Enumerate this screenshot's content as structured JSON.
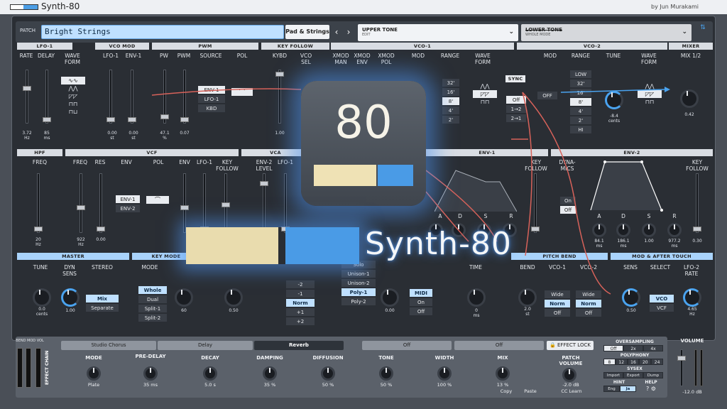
{
  "app": {
    "title": "Synth-80",
    "author": "by Jun Murakami"
  },
  "patch": {
    "label": "PATCH",
    "name": "Bright Strings",
    "category": "Pad & Strings"
  },
  "tones": {
    "upper": {
      "name": "UPPER TONE",
      "sub": "EDIT"
    },
    "lower": {
      "name": "LOWER TONE",
      "sub": "WHOLE MODE"
    }
  },
  "sections": {
    "lfo1": "LFO-1",
    "vcomod": "VCO MOD",
    "pwm": "PWM",
    "keyfollow": "KEY FOLLOW",
    "vco1": "VCO-1",
    "vco2": "VCO-2",
    "mixer": "MIXER",
    "hpf": "HPF",
    "vcf": "VCF",
    "vca": "VCA",
    "env1": "ENV-1",
    "env2": "ENV-2",
    "master": "MASTER",
    "keymode": "KEY MODE",
    "pitchbend": "PITCH BEND",
    "modafter": "MOD & AFTER TOUCH"
  },
  "lfo1": {
    "rate_label": "RATE",
    "delay_label": "DELAY",
    "wave_label": "WAVE FORM",
    "rate_value": "3.72",
    "rate_unit": "Hz",
    "delay_value": "85",
    "delay_unit": "ms"
  },
  "vcomod": {
    "lfo1_label": "LFO-1",
    "env1_label": "ENV-1",
    "lfo1_value": "0.00",
    "lfo1_unit": "st",
    "env1_value": "0.00",
    "env1_unit": "st"
  },
  "pwm": {
    "pw_label": "PW",
    "pwm_label": "PWM",
    "source_label": "SOURCE",
    "pol_label": "POL",
    "pw_value": "47.1",
    "pw_unit": "%",
    "pwm_value": "0.07",
    "sources": [
      "ENV-1",
      "LFO-1",
      "KBD"
    ]
  },
  "keyfollow": {
    "kybd_label": "KYBD",
    "vcosel_label": "VCO SEL",
    "kybd_value": "1.00"
  },
  "vco1": {
    "xmodman_label": "XMOD MAN",
    "xmodenv_label": "XMOD ENV",
    "xmodpol_label": "XMOD POL",
    "mod_label": "MOD",
    "range_label": "RANGE",
    "wave_label": "WAVE FORM",
    "ranges": [
      "32'",
      "16'",
      "8'",
      "4'",
      "2'"
    ],
    "range_selected": 2
  },
  "vco2": {
    "mod_label": "MOD",
    "range_label": "RANGE",
    "tune_label": "TUNE",
    "wave_label": "WAVE FORM",
    "sync_label": "SYNC",
    "sync_options": [
      "Off",
      "1→2",
      "2→1"
    ],
    "mod_value": "OFF",
    "ranges": [
      "LOW",
      "32'",
      "16'",
      "8'",
      "4'",
      "2'",
      "HI"
    ],
    "range_selected": 3,
    "tune_value": "-8.4",
    "tune_unit": "cents"
  },
  "mixer": {
    "mix_label": "MIX 1/2",
    "mix_value": "0.42"
  },
  "hpf": {
    "freq_label": "FREQ",
    "freq_value": "20",
    "freq_unit": "Hz"
  },
  "vcf": {
    "freq_label": "FREQ",
    "res_label": "RES",
    "env_label": "ENV",
    "pol_label": "POL",
    "env2_label": "ENV",
    "lfo1_label": "LFO-1",
    "kf_label": "KEY FOLLOW",
    "freq_value": "922",
    "freq_unit": "Hz",
    "res_value": "0.00",
    "sources": [
      "ENV-1",
      "ENV-2"
    ]
  },
  "vca": {
    "env2_label": "ENV-2 LEVEL",
    "lfo1_label": "LFO-1"
  },
  "env1": {
    "kf_label": "KEY FOLLOW",
    "dyn_label": "DYNA- MICS",
    "a": "A",
    "d": "D",
    "s": "S",
    "r": "R",
    "dyn_options": [
      "On",
      "Off"
    ]
  },
  "env2": {
    "a": "A",
    "d": "D",
    "s": "S",
    "r": "R",
    "kf_label": "KEY FOLLOW",
    "a_value": "84.1",
    "a_unit": "ms",
    "d_value": "186.1",
    "d_unit": "ms",
    "s_value": "1.00",
    "r_value": "977.2",
    "r_unit": "ms",
    "kf_value": "0.30"
  },
  "master": {
    "tune_label": "TUNE",
    "dyn_label": "DYN SENS",
    "stereo_label": "STEREO",
    "tune_value": "0.0",
    "tune_unit": "cents",
    "dyn_value": "1.00",
    "stereo_options": [
      "Mix",
      "Separate"
    ]
  },
  "keymode": {
    "mode_label": "MODE",
    "split_label": "SPLIT POINT",
    "upper_label": "LOWER UPPER",
    "modes": [
      "Whole",
      "Dual",
      "Split-1",
      "Split-2"
    ],
    "split_value": "60",
    "upper_value": "0.50"
  },
  "shift": {
    "label": "SHIFT",
    "options": [
      "-2",
      "-1",
      "Norm",
      "+1",
      "+2"
    ]
  },
  "assign": {
    "label": "ASSIGN",
    "options": [
      "Solo",
      "Unison-1",
      "Unison-2",
      "Poly-1",
      "Poly-2"
    ],
    "detune_label": "DETUNE",
    "detune_value": "0.00"
  },
  "hold": {
    "label": "HOLD",
    "options": [
      "MIDI",
      "On",
      "Off"
    ]
  },
  "porta": {
    "label": "TIME",
    "value": "0",
    "unit": "ms"
  },
  "pitchbend": {
    "bend_label": "BEND",
    "vco1_label": "VCO-1",
    "vco2_label": "VCO-2",
    "bend_value": "2.0",
    "bend_unit": "st",
    "options": [
      "Wide",
      "Norm",
      "Off"
    ]
  },
  "modafter": {
    "sens_label": "SENS",
    "select_label": "SELECT",
    "rate_label": "LFO-2 RATE",
    "sens_value": "0.50",
    "select_options": [
      "VCO",
      "VCF"
    ],
    "rate_value": "4.65",
    "rate_unit": "Hz"
  },
  "effects": {
    "bendmod_label": "BEND MOD VOL",
    "chain_label": "EFFECT CHAIN",
    "slots": [
      "Studio Chorus",
      "Delay",
      "Reverb",
      "Off",
      "Off"
    ],
    "selected": 2,
    "lock_label": "EFFECT LOCK",
    "params": [
      {
        "label": "MODE",
        "value": "Plate"
      },
      {
        "label": "PRE-DELAY",
        "value": "35 ms"
      },
      {
        "label": "DECAY",
        "value": "5.0 s"
      },
      {
        "label": "DAMPING",
        "value": "35 %"
      },
      {
        "label": "DIFFUSION",
        "value": "50 %"
      },
      {
        "label": "TONE",
        "value": "50 %"
      },
      {
        "label": "WIDTH",
        "value": "100 %"
      },
      {
        "label": "MIX",
        "value": "13 %"
      }
    ],
    "patchvol_label": "PATCH VOLUME",
    "patchvol_value": "-2.0 dB",
    "copy_label": "Copy",
    "paste_label": "Paste",
    "cc_label": "CC Learn"
  },
  "oversampling": {
    "label": "OVERSAMPLING",
    "options": [
      "Off",
      "2x",
      "4x"
    ]
  },
  "polyphony": {
    "label": "POLYPHONY",
    "options": [
      "8",
      "12",
      "16",
      "20",
      "24"
    ]
  },
  "sysex": {
    "label": "SYSEX",
    "import": "Import",
    "export": "Export",
    "dump": "Dump"
  },
  "hint": {
    "label": "HINT",
    "options": [
      "Eng",
      "Ja"
    ]
  },
  "help": {
    "label": "HELP"
  },
  "volume": {
    "label": "VOLUME",
    "value": "-12.0 dB"
  },
  "overlay": {
    "icon_text": "80",
    "wordmark": "Synth-80"
  },
  "colors": {
    "accent": "#4aa3ef",
    "header": "#d9dde3",
    "header_blue": "#a9d3fb",
    "panel": "#2a2e34",
    "cable": "#d8625a"
  }
}
